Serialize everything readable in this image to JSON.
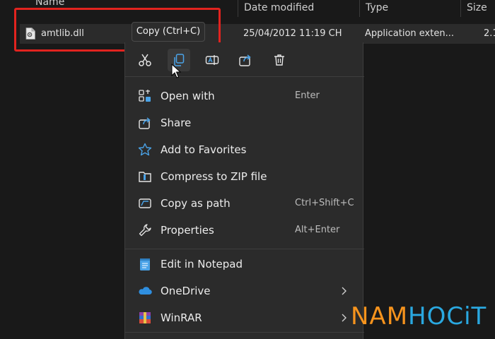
{
  "columns": {
    "name": "Name",
    "date_modified": "Date modified",
    "type": "Type",
    "size": "Size"
  },
  "file": {
    "name": "amtlib.dll",
    "date_modified": "25/04/2012 11:19 CH",
    "type": "Application exten...",
    "size": "2.1"
  },
  "tooltip": "Copy (Ctrl+C)",
  "quick_actions": [
    {
      "icon": "cut-icon"
    },
    {
      "icon": "copy-icon"
    },
    {
      "icon": "rename-icon"
    },
    {
      "icon": "share-icon"
    },
    {
      "icon": "delete-icon"
    }
  ],
  "menu_items": [
    {
      "label": "Open with",
      "shortcut": "Enter",
      "icon": "open-with-icon"
    },
    {
      "label": "Share",
      "shortcut": "",
      "icon": "share-icon"
    },
    {
      "label": "Add to Favorites",
      "shortcut": "",
      "icon": "star-icon"
    },
    {
      "label": "Compress to ZIP file",
      "shortcut": "",
      "icon": "zip-folder-icon"
    },
    {
      "label": "Copy as path",
      "shortcut": "Ctrl+Shift+C",
      "icon": "copy-path-icon"
    },
    {
      "label": "Properties",
      "shortcut": "Alt+Enter",
      "icon": "wrench-icon"
    },
    {
      "label": "Edit in Notepad",
      "shortcut": "",
      "icon": "notepad-icon"
    },
    {
      "label": "OneDrive",
      "shortcut": "",
      "icon": "onedrive-cloud-icon"
    },
    {
      "label": "WinRAR",
      "shortcut": "",
      "icon": "winrar-icon"
    }
  ],
  "watermark": {
    "part1": "NAM",
    "part2": "HOCiT"
  },
  "colors": {
    "highlight_border": "#e1231f",
    "accent_blue": "#4aa3e8",
    "watermark_orange": "#f7941d",
    "watermark_blue": "#2aa8e0"
  }
}
